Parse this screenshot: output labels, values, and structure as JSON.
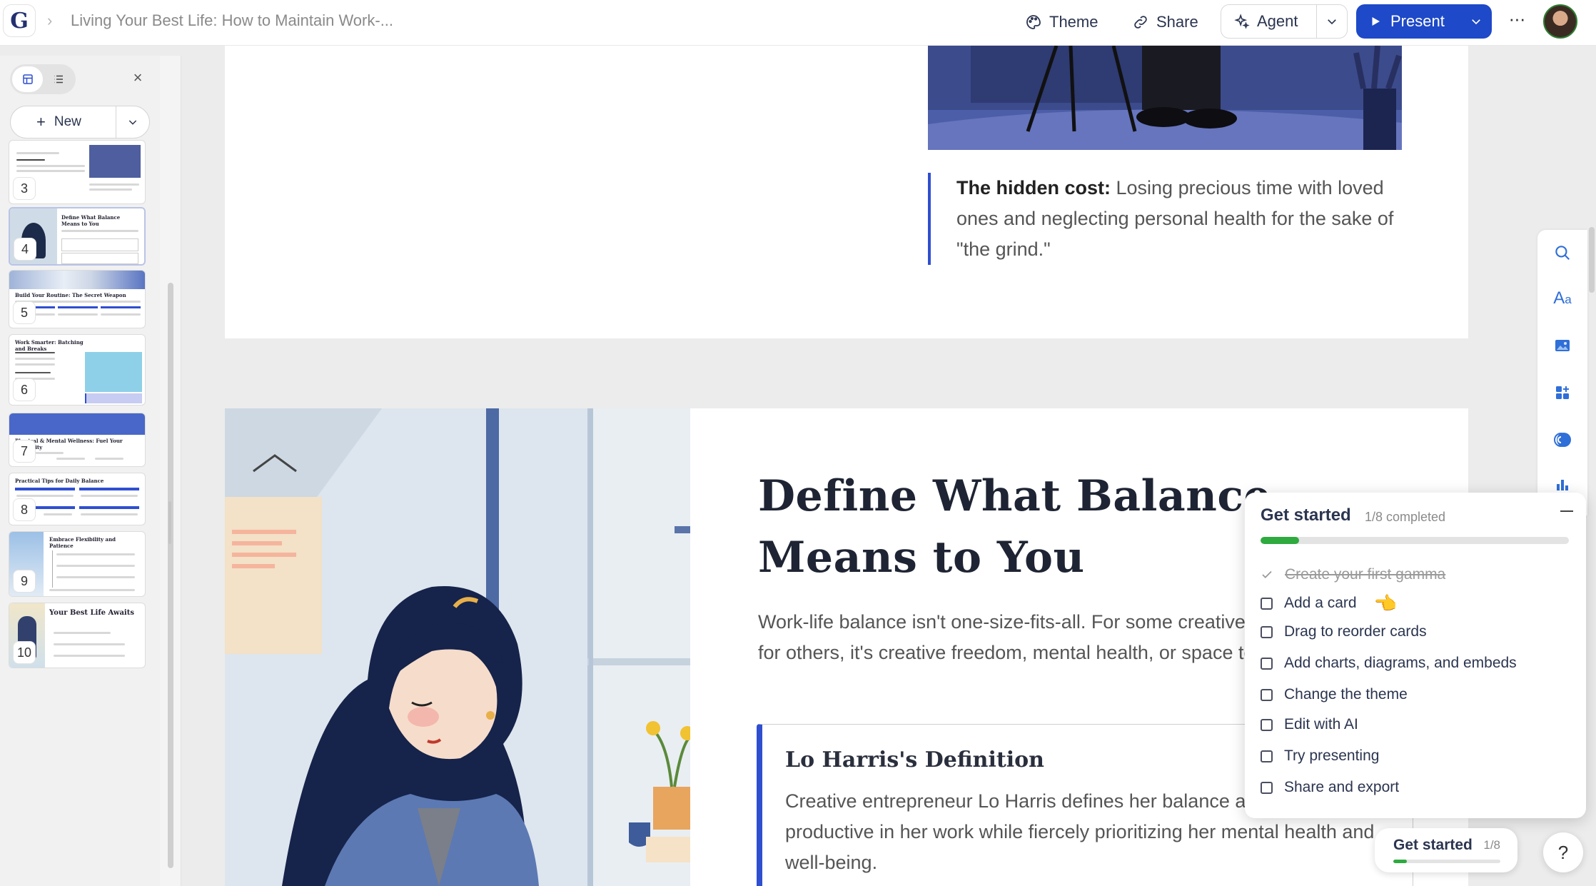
{
  "app": {
    "logo_letter": "G"
  },
  "header": {
    "doc_title": "Living Your Best Life: How to Maintain Work-...",
    "theme_label": "Theme",
    "share_label": "Share",
    "agent_label": "Agent",
    "present_label": "Present",
    "more_label": "···"
  },
  "sidebar": {
    "new_label": "New",
    "slides": [
      {
        "number": "3"
      },
      {
        "number": "4",
        "title": "Define What Balance Means to You"
      },
      {
        "number": "5",
        "title": "Build Your Routine: The Secret Weapon"
      },
      {
        "number": "6",
        "title": "Work Smarter: Batching and Breaks"
      },
      {
        "number": "7",
        "title": "Physical & Mental Wellness: Fuel Your Creativity"
      },
      {
        "number": "8",
        "title": "Practical Tips for Daily Balance"
      },
      {
        "number": "9",
        "title": "Embrace Flexibility and Patience"
      },
      {
        "number": "10",
        "title": "Your Best Life Awaits"
      }
    ]
  },
  "card1": {
    "quote_bold": "The hidden cost:",
    "quote_text": " Losing precious time with loved ones and neglecting personal health for the sake of \"the grind.\""
  },
  "card2": {
    "title": "Define What Balance Means to You",
    "body": "Work-life balance isn't one-size-fits-all. For some creatives, it's family time; for others, it's creative freedom, mental health, or space to breathe.",
    "definition_title": "Lo Harris's Definition",
    "definition_body": "Creative entrepreneur Lo Harris defines her balance as being productive in her work while fiercely prioritizing her mental health and well-being."
  },
  "get_started": {
    "title": "Get started",
    "progress_text": "1/8 completed",
    "progress_fraction": 0.125,
    "items": [
      {
        "label": "Create your first gamma",
        "done": true
      },
      {
        "label": "Add a card",
        "done": false
      },
      {
        "label": "Drag to reorder cards",
        "done": false
      },
      {
        "label": "Add charts, diagrams, and embeds",
        "done": false
      },
      {
        "label": "Change the theme",
        "done": false
      },
      {
        "label": "Edit with AI",
        "done": false
      },
      {
        "label": "Try presenting",
        "done": false
      },
      {
        "label": "Share and export",
        "done": false
      }
    ],
    "pill_label": "Get started",
    "pill_count": "1/8",
    "help_label": "?"
  },
  "colors": {
    "accent": "#1e49c8",
    "progress": "#2eaa3f",
    "quote_bar": "#2f4fd0"
  }
}
